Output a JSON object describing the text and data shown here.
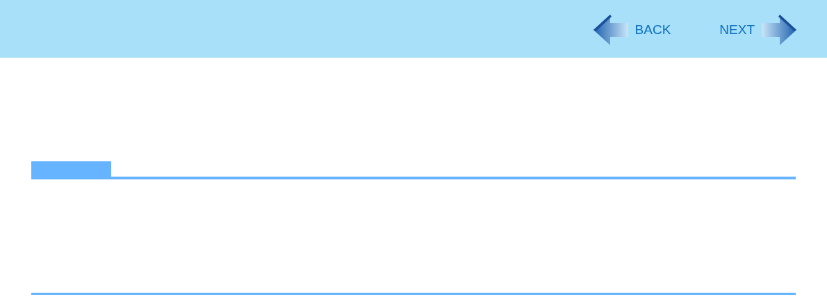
{
  "nav": [
    {
      "kind": "back",
      "label": "BACK"
    },
    {
      "kind": "next",
      "label": "NEXT"
    }
  ]
}
